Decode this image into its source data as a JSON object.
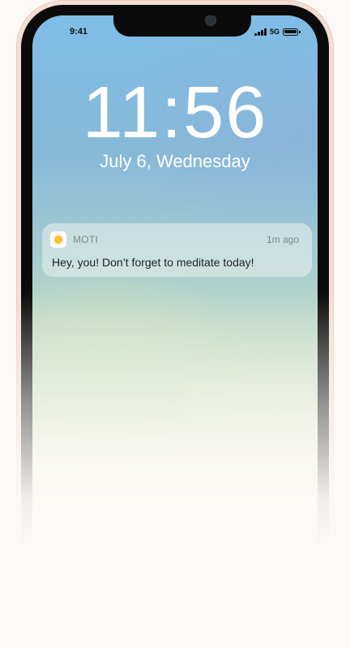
{
  "status_bar": {
    "time": "9:41",
    "network": "5G",
    "icons": [
      "camera-icon",
      "signal-icon",
      "battery-icon"
    ]
  },
  "lock_screen": {
    "time": "11:56",
    "date": "July 6, Wednesday"
  },
  "notification": {
    "app_icon": "sun-icon",
    "app_name": "MOTI",
    "time": "1m ago",
    "message": "Hey, you! Don’t forget to meditate today!"
  },
  "colors": {
    "frame": "#f4ddd6",
    "bezel": "#0b0b0b",
    "sky_top": "#7fbde6",
    "background": "#fcfaf6"
  }
}
